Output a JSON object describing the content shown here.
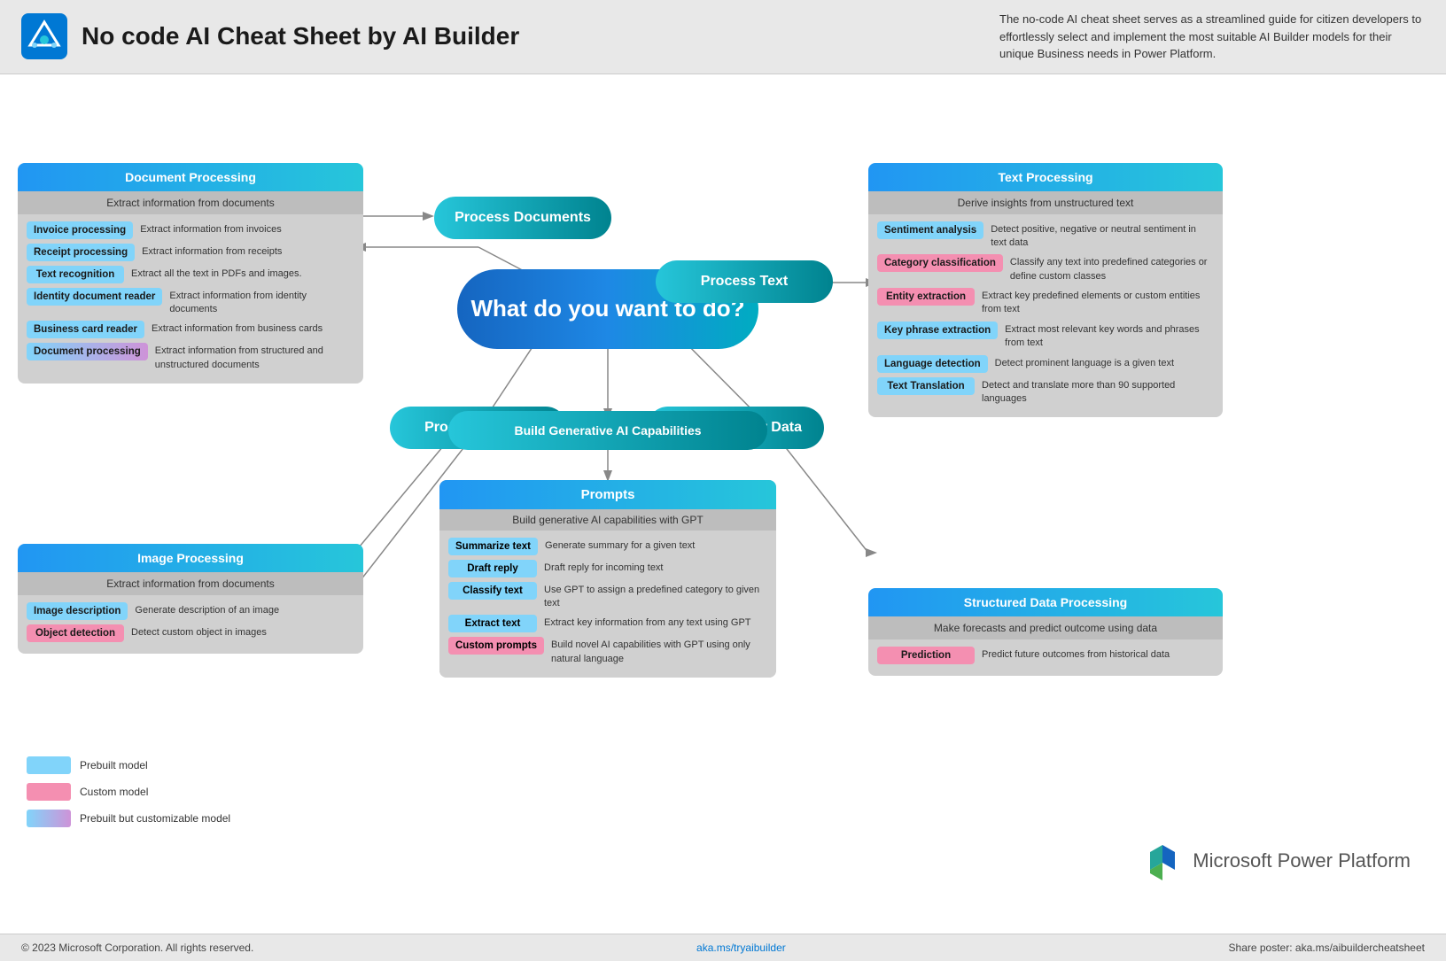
{
  "header": {
    "title": "No code AI Cheat Sheet by AI Builder",
    "description": "The no-code AI cheat sheet serves as a streamlined guide for citizen developers to effortlessly select and implement the most suitable AI Builder models for their unique Business needs in Power Platform."
  },
  "central": {
    "main_label": "What do you want to do?"
  },
  "nodes": {
    "process_documents": "Process Documents",
    "process_text": "Process Text",
    "process_images": "Process Images",
    "act_tabular": "Act on Tabular Data",
    "build_generative": "Build Generative AI Capabilities"
  },
  "document_processing": {
    "title": "Document Processing",
    "subtitle": "Extract information from documents",
    "items": [
      {
        "label": "Invoice processing",
        "desc": "Extract information from invoices",
        "color": "blue"
      },
      {
        "label": "Receipt processing",
        "desc": "Extract information from receipts",
        "color": "blue"
      },
      {
        "label": "Text  recognition",
        "desc": "Extract all the text in PDFs and images.",
        "color": "blue"
      },
      {
        "label": "Identity document reader",
        "desc": "Extract information from identity documents",
        "color": "blue"
      },
      {
        "label": "Business card reader",
        "desc": "Extract information from business cards",
        "color": "blue"
      },
      {
        "label": "Document processing",
        "desc": "Extract information from structured and unstructured documents",
        "color": "gradient"
      }
    ]
  },
  "image_processing": {
    "title": "Image Processing",
    "subtitle": "Extract information from documents",
    "items": [
      {
        "label": "Image description",
        "desc": "Generate description of an image",
        "color": "blue"
      },
      {
        "label": "Object detection",
        "desc": "Detect custom object in images",
        "color": "pink"
      }
    ]
  },
  "text_processing": {
    "title": "Text Processing",
    "subtitle": "Derive insights from unstructured text",
    "items": [
      {
        "label": "Sentiment analysis",
        "desc": "Detect positive, negative or neutral sentiment in text data",
        "color": "blue"
      },
      {
        "label": "Category classification",
        "desc": "Classify any text into predefined categories or define custom classes",
        "color": "pink"
      },
      {
        "label": "Entity extraction",
        "desc": "Extract key predefined elements or custom entities from text",
        "color": "pink"
      },
      {
        "label": "Key phrase extraction",
        "desc": "Extract most relevant key words and phrases from text",
        "color": "blue"
      },
      {
        "label": "Language detection",
        "desc": "Detect prominent language is a given text",
        "color": "blue"
      },
      {
        "label": "Text Translation",
        "desc": "Detect and translate more than 90 supported languages",
        "color": "blue"
      }
    ]
  },
  "structured_data": {
    "title": "Structured Data Processing",
    "subtitle": "Make forecasts and predict outcome using data",
    "items": [
      {
        "label": "Prediction",
        "desc": "Predict future outcomes from historical data",
        "color": "pink"
      }
    ]
  },
  "prompts": {
    "title": "Prompts",
    "subtitle": "Build generative AI capabilities with GPT",
    "items": [
      {
        "label": "Summarize text",
        "desc": "Generate summary for a given text",
        "color": "blue"
      },
      {
        "label": "Draft reply",
        "desc": "Draft reply for incoming text",
        "color": "blue"
      },
      {
        "label": "Classify text",
        "desc": "Use GPT to assign a predefined category to given text",
        "color": "blue"
      },
      {
        "label": "Extract text",
        "desc": "Extract key information from any text using GPT",
        "color": "blue"
      },
      {
        "label": "Custom prompts",
        "desc": "Build novel AI capabilities with GPT using only natural language",
        "color": "pink"
      }
    ]
  },
  "legend": {
    "items": [
      {
        "label": "Prebuilt model",
        "type": "blue"
      },
      {
        "label": "Custom model",
        "type": "pink"
      },
      {
        "label": "Prebuilt but customizable model",
        "type": "gradient"
      }
    ]
  },
  "footer": {
    "copyright": "© 2023 Microsoft Corporation. All rights reserved.",
    "link": "aka.ms/tryaibuilder",
    "share": "Share poster: aka.ms/aibuildercheatsheet"
  },
  "power_platform": {
    "text": "Microsoft Power Platform"
  }
}
